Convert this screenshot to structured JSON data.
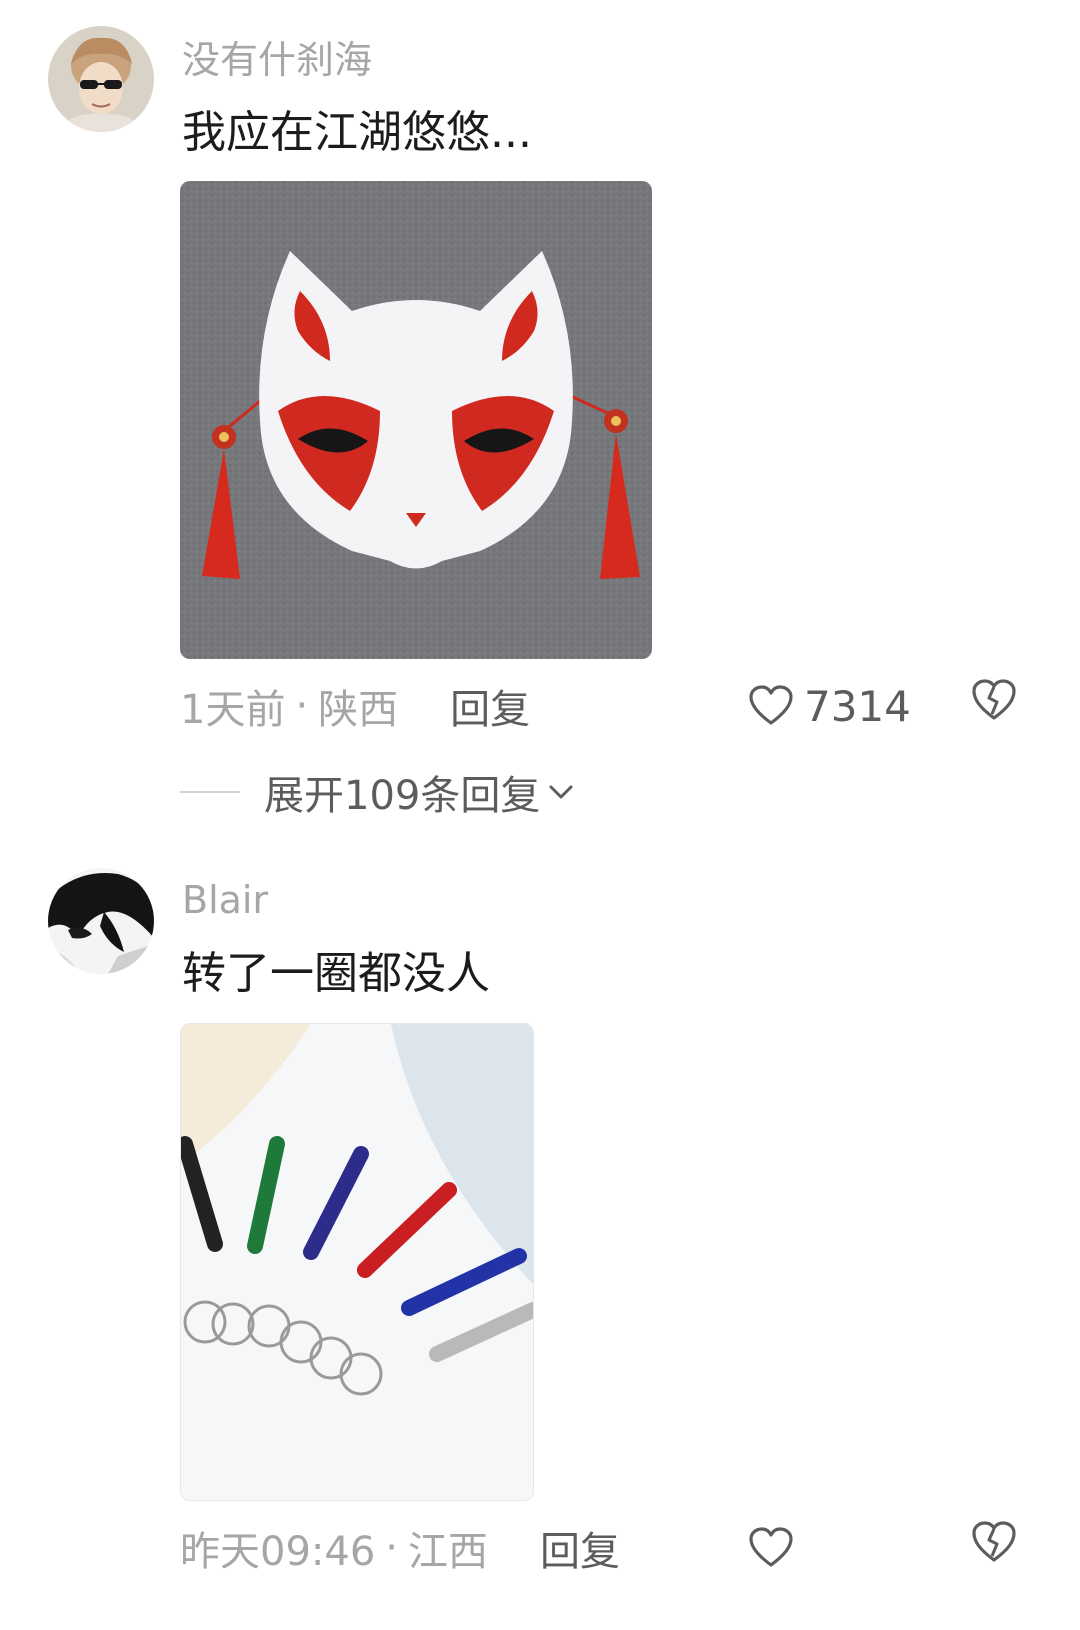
{
  "comments": [
    {
      "username": "没有什刹海",
      "text": "我应在江湖悠悠...",
      "avatar_icon": "user-avatar-sunglasses",
      "image_icon": "fox-mask-photo",
      "time": "1天前",
      "separator": "·",
      "location": "陕西",
      "reply_label": "回复",
      "like_count": "7314",
      "expand_label": "展开109条回复"
    },
    {
      "username": "Blair",
      "text": "转了一圈都没人",
      "avatar_icon": "user-avatar-anime",
      "image_icon": "laser-pointer-keychains-photo",
      "time": "昨天09:46",
      "separator": "·",
      "location": "江西",
      "reply_label": "回复"
    }
  ],
  "colors": {
    "background": "#ffffff",
    "text_primary": "#1c1c1c",
    "text_secondary": "#a6a6a6",
    "action": "#5c5c5c"
  }
}
